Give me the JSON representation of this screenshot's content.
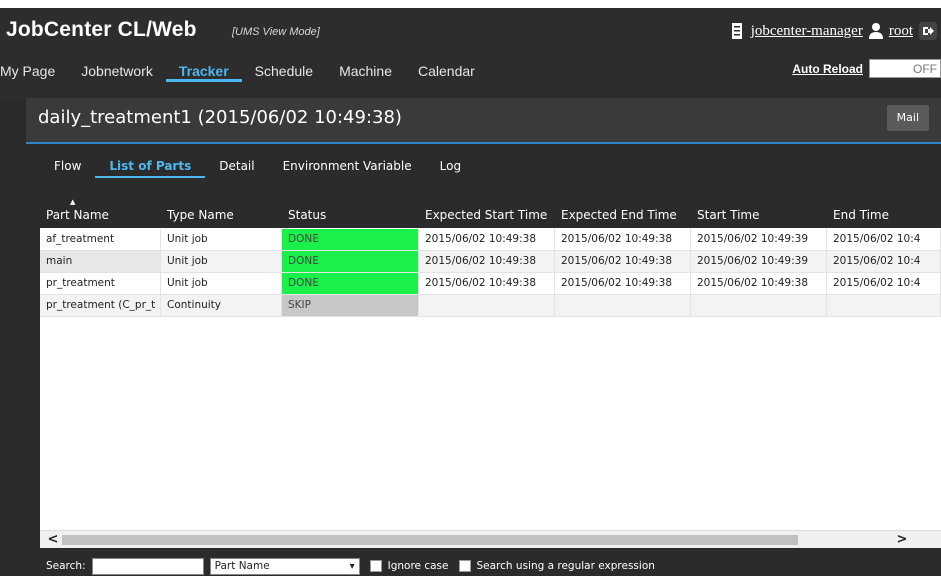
{
  "app": {
    "title": "JobCenter CL/Web",
    "mode": "[UMS View Mode]"
  },
  "user": {
    "server_link": "jobcenter-manager",
    "user_link": "root"
  },
  "nav": {
    "items": [
      "My Page",
      "Jobnetwork",
      "Tracker",
      "Schedule",
      "Machine",
      "Calendar"
    ],
    "active": "Tracker"
  },
  "autoreload": {
    "label": "Auto Reload",
    "state": "OFF"
  },
  "panel": {
    "title": "daily_treatment1 (2015/06/02 10:49:38)",
    "mail_label": "Mail"
  },
  "subtabs": {
    "items": [
      "Flow",
      "List of Parts",
      "Detail",
      "Environment Variable",
      "Log"
    ],
    "active": "List of Parts"
  },
  "table": {
    "columns": [
      "Part Name",
      "Type Name",
      "Status",
      "Expected Start Time",
      "Expected End Time",
      "Start Time",
      "End Time"
    ],
    "rows": [
      [
        "af_treatment",
        "Unit job",
        "DONE",
        "2015/06/02 10:49:38",
        "2015/06/02 10:49:38",
        "2015/06/02 10:49:39",
        "2015/06/02 10:4"
      ],
      [
        "main",
        "Unit job",
        "DONE",
        "2015/06/02 10:49:38",
        "2015/06/02 10:49:38",
        "2015/06/02 10:49:39",
        "2015/06/02 10:4"
      ],
      [
        "pr_treatment",
        "Unit job",
        "DONE",
        "2015/06/02 10:49:38",
        "2015/06/02 10:49:38",
        "2015/06/02 10:49:38",
        "2015/06/02 10:4"
      ],
      [
        "pr_treatment (C_pr_t",
        "Continuity",
        "SKIP",
        "",
        "",
        "",
        ""
      ]
    ]
  },
  "search": {
    "label": "Search:",
    "field_select": "Part Name",
    "ignore_case": "Ignore case",
    "regex": "Search using a regular expression"
  },
  "colors": {
    "accent": "#4cb8f0",
    "done": "#19f04a",
    "skip": "#c7c7c7"
  }
}
